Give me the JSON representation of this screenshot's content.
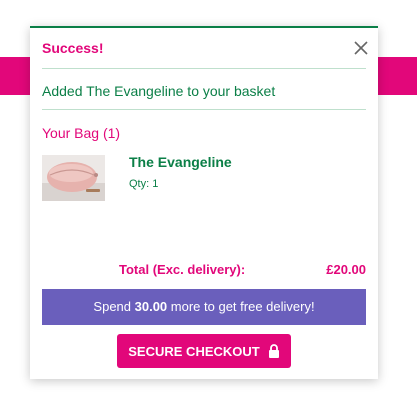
{
  "colors": {
    "brand_pink": "#e2077a",
    "brand_green": "#0b7f47",
    "banner_purple": "#6a5fbc",
    "divider": "#bfe0cd"
  },
  "modal": {
    "status_title": "Success!",
    "close_icon": "close-icon",
    "added_message": "Added The Evangeline to your basket"
  },
  "bag": {
    "title": "Your Bag (1)",
    "items": [
      {
        "name": "The Evangeline",
        "qty": "Qty: 1",
        "thumbnail_icon": "product-thumbnail-pink-pouch"
      }
    ],
    "total_label": "Total (Exc. delivery):",
    "total_value": "£20.00"
  },
  "delivery_banner": {
    "prefix": "Spend ",
    "amount": "30.00",
    "suffix": " more to get free delivery!"
  },
  "checkout": {
    "label": "SECURE CHECKOUT",
    "icon": "lock-icon"
  }
}
